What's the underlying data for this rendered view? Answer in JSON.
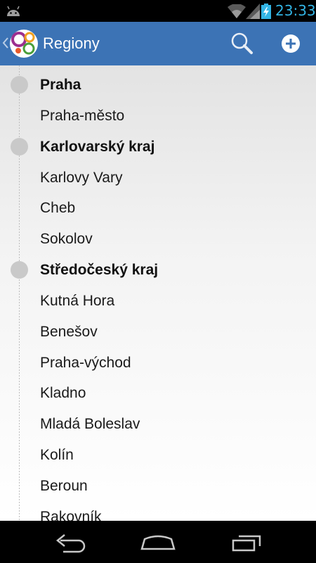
{
  "status_bar": {
    "time": "23:33"
  },
  "action_bar": {
    "title": "Regiony",
    "icons": [
      "chevron-left-icon",
      "app-logo",
      "search-icon",
      "add-icon"
    ]
  },
  "regions": [
    {
      "label": "Praha",
      "type": "header"
    },
    {
      "label": "Praha-město",
      "type": "item"
    },
    {
      "label": "Karlovarský kraj",
      "type": "header"
    },
    {
      "label": "Karlovy Vary",
      "type": "item"
    },
    {
      "label": "Cheb",
      "type": "item"
    },
    {
      "label": "Sokolov",
      "type": "item"
    },
    {
      "label": "Středočeský kraj",
      "type": "header"
    },
    {
      "label": "Kutná Hora",
      "type": "item"
    },
    {
      "label": "Benešov",
      "type": "item"
    },
    {
      "label": "Praha-východ",
      "type": "item"
    },
    {
      "label": "Kladno",
      "type": "item"
    },
    {
      "label": "Mladá Boleslav",
      "type": "item"
    },
    {
      "label": "Kolín",
      "type": "item"
    },
    {
      "label": "Beroun",
      "type": "item"
    },
    {
      "label": "Rakovník",
      "type": "item"
    }
  ],
  "nav_bar": {
    "buttons": [
      "back-icon",
      "home-icon",
      "recents-icon"
    ]
  },
  "colors": {
    "action_bar": "#3c73b5",
    "status_accent": "#33b5e5",
    "timeline_dot": "#c9c9c9"
  }
}
